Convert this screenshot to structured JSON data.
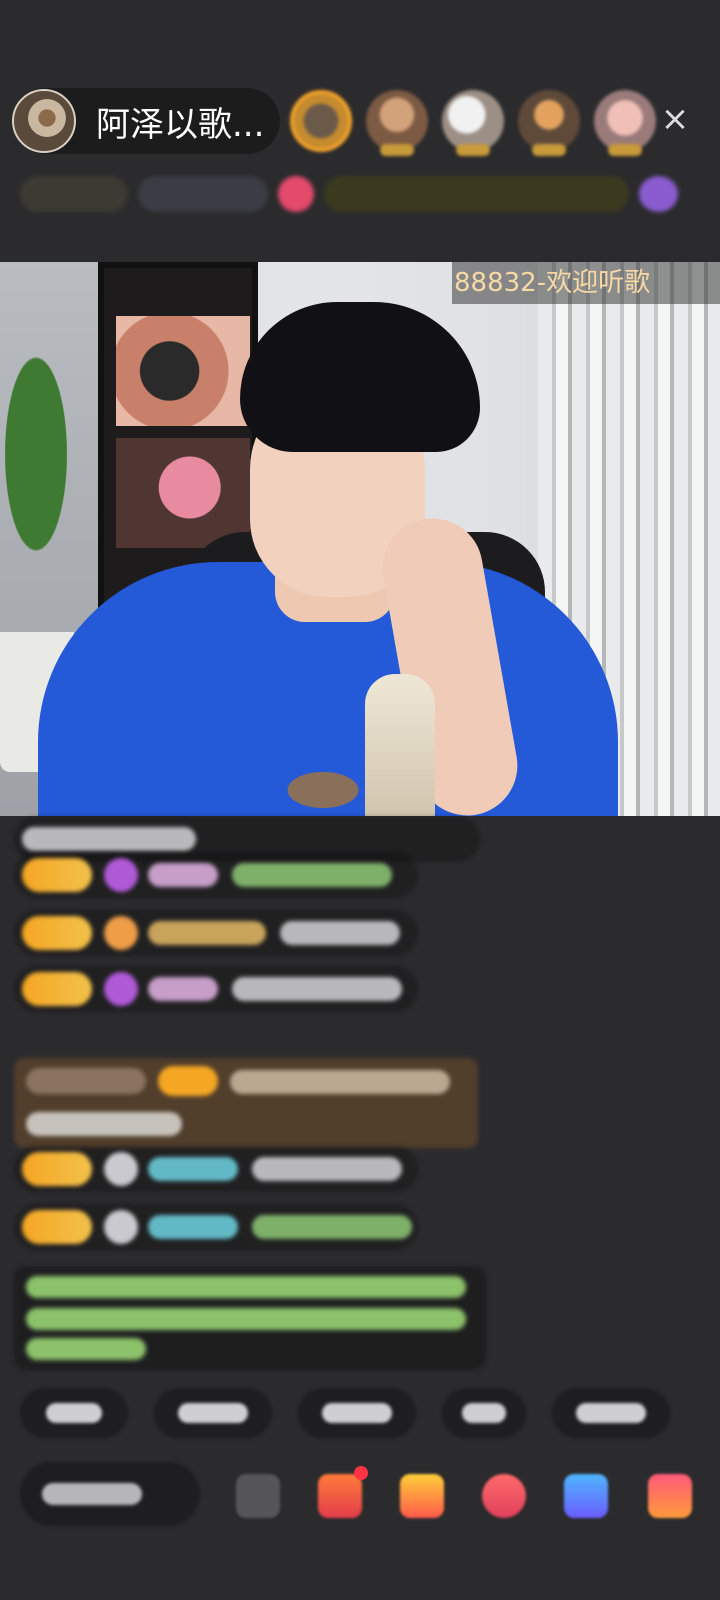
{
  "header": {
    "host_name": "阿泽以歌...",
    "close_glyph": "×"
  },
  "video": {
    "room_label": "88832-欢迎听歌"
  },
  "colors": {
    "background": "#2b2b2d",
    "room_label_text": "#f7d9a6",
    "level_badge": "#f5a623"
  },
  "icons": {
    "close": "close-icon",
    "gift": "gift-icon"
  }
}
